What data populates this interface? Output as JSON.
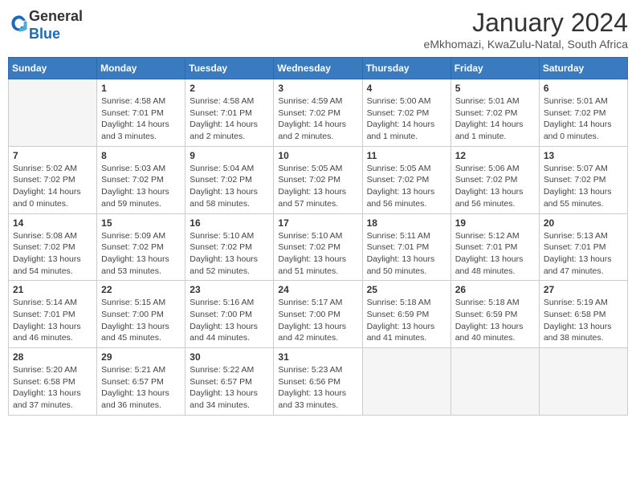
{
  "header": {
    "logo_general": "General",
    "logo_blue": "Blue",
    "month_title": "January 2024",
    "subtitle": "eMkhomazi, KwaZulu-Natal, South Africa"
  },
  "days_of_week": [
    "Sunday",
    "Monday",
    "Tuesday",
    "Wednesday",
    "Thursday",
    "Friday",
    "Saturday"
  ],
  "weeks": [
    [
      {
        "day": "",
        "info": ""
      },
      {
        "day": "1",
        "info": "Sunrise: 4:58 AM\nSunset: 7:01 PM\nDaylight: 14 hours\nand 3 minutes."
      },
      {
        "day": "2",
        "info": "Sunrise: 4:58 AM\nSunset: 7:01 PM\nDaylight: 14 hours\nand 2 minutes."
      },
      {
        "day": "3",
        "info": "Sunrise: 4:59 AM\nSunset: 7:02 PM\nDaylight: 14 hours\nand 2 minutes."
      },
      {
        "day": "4",
        "info": "Sunrise: 5:00 AM\nSunset: 7:02 PM\nDaylight: 14 hours\nand 1 minute."
      },
      {
        "day": "5",
        "info": "Sunrise: 5:01 AM\nSunset: 7:02 PM\nDaylight: 14 hours\nand 1 minute."
      },
      {
        "day": "6",
        "info": "Sunrise: 5:01 AM\nSunset: 7:02 PM\nDaylight: 14 hours\nand 0 minutes."
      }
    ],
    [
      {
        "day": "7",
        "info": "Sunrise: 5:02 AM\nSunset: 7:02 PM\nDaylight: 14 hours\nand 0 minutes."
      },
      {
        "day": "8",
        "info": "Sunrise: 5:03 AM\nSunset: 7:02 PM\nDaylight: 13 hours\nand 59 minutes."
      },
      {
        "day": "9",
        "info": "Sunrise: 5:04 AM\nSunset: 7:02 PM\nDaylight: 13 hours\nand 58 minutes."
      },
      {
        "day": "10",
        "info": "Sunrise: 5:05 AM\nSunset: 7:02 PM\nDaylight: 13 hours\nand 57 minutes."
      },
      {
        "day": "11",
        "info": "Sunrise: 5:05 AM\nSunset: 7:02 PM\nDaylight: 13 hours\nand 56 minutes."
      },
      {
        "day": "12",
        "info": "Sunrise: 5:06 AM\nSunset: 7:02 PM\nDaylight: 13 hours\nand 56 minutes."
      },
      {
        "day": "13",
        "info": "Sunrise: 5:07 AM\nSunset: 7:02 PM\nDaylight: 13 hours\nand 55 minutes."
      }
    ],
    [
      {
        "day": "14",
        "info": "Sunrise: 5:08 AM\nSunset: 7:02 PM\nDaylight: 13 hours\nand 54 minutes."
      },
      {
        "day": "15",
        "info": "Sunrise: 5:09 AM\nSunset: 7:02 PM\nDaylight: 13 hours\nand 53 minutes."
      },
      {
        "day": "16",
        "info": "Sunrise: 5:10 AM\nSunset: 7:02 PM\nDaylight: 13 hours\nand 52 minutes."
      },
      {
        "day": "17",
        "info": "Sunrise: 5:10 AM\nSunset: 7:02 PM\nDaylight: 13 hours\nand 51 minutes."
      },
      {
        "day": "18",
        "info": "Sunrise: 5:11 AM\nSunset: 7:01 PM\nDaylight: 13 hours\nand 50 minutes."
      },
      {
        "day": "19",
        "info": "Sunrise: 5:12 AM\nSunset: 7:01 PM\nDaylight: 13 hours\nand 48 minutes."
      },
      {
        "day": "20",
        "info": "Sunrise: 5:13 AM\nSunset: 7:01 PM\nDaylight: 13 hours\nand 47 minutes."
      }
    ],
    [
      {
        "day": "21",
        "info": "Sunrise: 5:14 AM\nSunset: 7:01 PM\nDaylight: 13 hours\nand 46 minutes."
      },
      {
        "day": "22",
        "info": "Sunrise: 5:15 AM\nSunset: 7:00 PM\nDaylight: 13 hours\nand 45 minutes."
      },
      {
        "day": "23",
        "info": "Sunrise: 5:16 AM\nSunset: 7:00 PM\nDaylight: 13 hours\nand 44 minutes."
      },
      {
        "day": "24",
        "info": "Sunrise: 5:17 AM\nSunset: 7:00 PM\nDaylight: 13 hours\nand 42 minutes."
      },
      {
        "day": "25",
        "info": "Sunrise: 5:18 AM\nSunset: 6:59 PM\nDaylight: 13 hours\nand 41 minutes."
      },
      {
        "day": "26",
        "info": "Sunrise: 5:18 AM\nSunset: 6:59 PM\nDaylight: 13 hours\nand 40 minutes."
      },
      {
        "day": "27",
        "info": "Sunrise: 5:19 AM\nSunset: 6:58 PM\nDaylight: 13 hours\nand 38 minutes."
      }
    ],
    [
      {
        "day": "28",
        "info": "Sunrise: 5:20 AM\nSunset: 6:58 PM\nDaylight: 13 hours\nand 37 minutes."
      },
      {
        "day": "29",
        "info": "Sunrise: 5:21 AM\nSunset: 6:57 PM\nDaylight: 13 hours\nand 36 minutes."
      },
      {
        "day": "30",
        "info": "Sunrise: 5:22 AM\nSunset: 6:57 PM\nDaylight: 13 hours\nand 34 minutes."
      },
      {
        "day": "31",
        "info": "Sunrise: 5:23 AM\nSunset: 6:56 PM\nDaylight: 13 hours\nand 33 minutes."
      },
      {
        "day": "",
        "info": ""
      },
      {
        "day": "",
        "info": ""
      },
      {
        "day": "",
        "info": ""
      }
    ]
  ]
}
